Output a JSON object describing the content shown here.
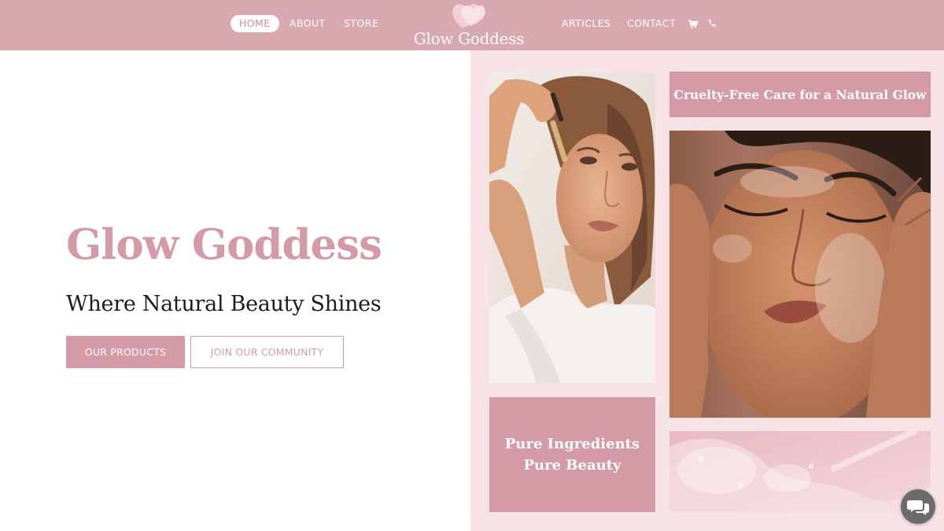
{
  "nav": {
    "items_left": [
      {
        "label": "HOME",
        "active": true
      },
      {
        "label": "ABOUT",
        "active": false
      },
      {
        "label": "STORE",
        "active": false
      }
    ],
    "items_right": [
      {
        "label": "ARTICLES",
        "active": false
      },
      {
        "label": "CONTACT",
        "active": false
      }
    ],
    "icons": [
      "cart-icon",
      "phone-icon"
    ],
    "logo_text": "Glow Goddess"
  },
  "hero": {
    "title": "Glow Goddess",
    "subtitle": "Where Natural Beauty Shines",
    "primary_button": "OUR PRODUCTS",
    "secondary_button": "JOIN OUR COMMUNITY"
  },
  "panel": {
    "tag_top": "Cruelty-Free Care for a Natural Glow",
    "tag_mid_line1": "Pure Ingredients",
    "tag_mid_line2": "Pure Beauty"
  },
  "chat": {
    "icon": "chat-bubbles-icon"
  },
  "colors": {
    "nav_bg": "#d8a8b0",
    "accent": "#d49ba6",
    "panel_bg": "#f7e3e6",
    "text_dark": "#1c1c1c"
  }
}
